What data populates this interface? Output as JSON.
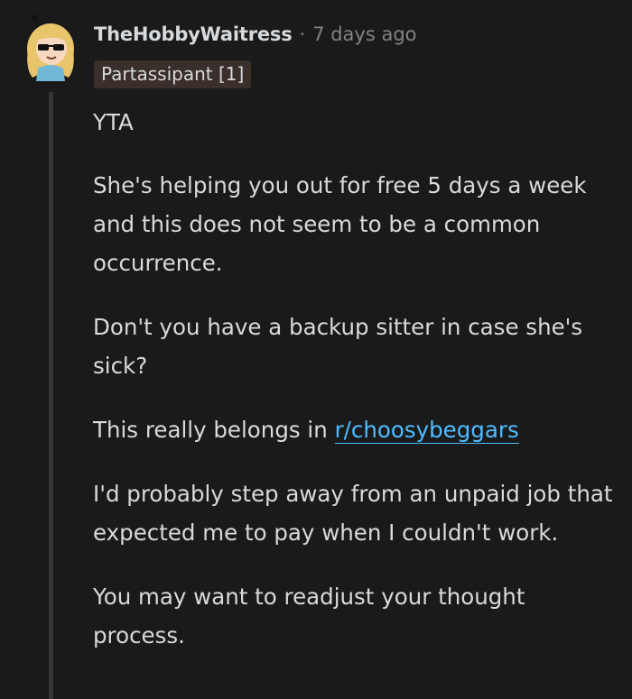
{
  "comment": {
    "author": "TheHobbyWaitress",
    "separator": "·",
    "timestamp": "7 days ago",
    "flair": "Partassipant [1]",
    "avatar_icon": "cartoon-avatar-icon",
    "paragraphs": {
      "p1": "YTA",
      "p2": "She's helping you out for free 5 days a week and this does not seem to be a common occurrence.",
      "p3": "Don't you have a backup sitter in case she's sick?",
      "p4_prefix": "This really belongs in ",
      "p4_link": "r/choosybeggars",
      "p5": "I'd probably step away from an unpaid job that expected me to pay when I couldn't work.",
      "p6": "You may want to readjust your thought process."
    }
  },
  "colors": {
    "background": "#1a1a1b",
    "text": "#d7dadc",
    "meta": "#818384",
    "link": "#4fbcff",
    "flair_bg": "#3a2f2a",
    "thread_line": "#343536"
  }
}
